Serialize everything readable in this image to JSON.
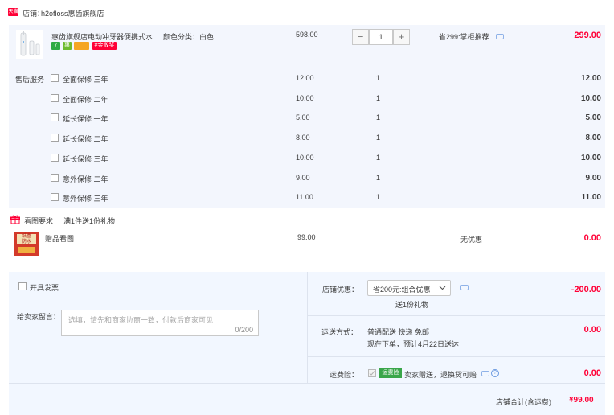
{
  "shop": {
    "badge": "天猫",
    "label": "店铺：",
    "name": "h2ofloss惠齿旗舰店"
  },
  "product": {
    "title": "惠齿旗舰店电动冲牙器便携式水...",
    "attr": "颜色分类：白色",
    "price": "598.00",
    "quantity": "1",
    "discount_note": "省299:掌柜推荐",
    "subtotal": "299.00",
    "tags": [
      "7",
      "惠",
      "",
      "#金敬奖"
    ],
    "tag_colors": [
      "#2eaa45",
      "#6dbb2e",
      "#f5a623",
      "#ff0036"
    ]
  },
  "service": {
    "label": "售后服务",
    "options": [
      {
        "name": "全面保修 三年",
        "price": "12.00",
        "qty": "1",
        "total": "12.00"
      },
      {
        "name": "全面保修 二年",
        "price": "10.00",
        "qty": "1",
        "total": "10.00"
      },
      {
        "name": "延长保修 一年",
        "price": "5.00",
        "qty": "1",
        "total": "5.00"
      },
      {
        "name": "延长保修 二年",
        "price": "8.00",
        "qty": "1",
        "total": "8.00"
      },
      {
        "name": "延长保修 三年",
        "price": "10.00",
        "qty": "1",
        "total": "10.00"
      },
      {
        "name": "意外保修 二年",
        "price": "9.00",
        "qty": "1",
        "total": "9.00"
      },
      {
        "name": "意外保修 三年",
        "price": "11.00",
        "qty": "1",
        "total": "11.00"
      }
    ]
  },
  "gift": {
    "label": "看图要求",
    "rule": "满1件送1份礼物",
    "item_name": "赠品看图",
    "price": "99.00",
    "discount": "无优惠",
    "total": "0.00",
    "thumb_text": "纸盒\n防水"
  },
  "invoice": {
    "label": "开具发票"
  },
  "message": {
    "label": "给卖家留言：",
    "placeholder": "选填，请先和商家协商一致，付款后商家可见",
    "counter": "0/200"
  },
  "shop_discount": {
    "label": "店铺优惠：",
    "selected": "省200元:组合优惠",
    "gift_note": "送1份礼物",
    "amount": "-200.00"
  },
  "shipping": {
    "label": "运送方式：",
    "method": "普通配送 快递 免邮",
    "eta": "现在下单，预计4月22日送达",
    "amount": "0.00"
  },
  "insurance": {
    "label": "运费险：",
    "badge": "运费险",
    "desc": "卖家赠送，退换货可赔",
    "amount": "0.00",
    "help": "?"
  },
  "total": {
    "label": "店铺合计(含运费)",
    "amount": "¥99.00"
  }
}
